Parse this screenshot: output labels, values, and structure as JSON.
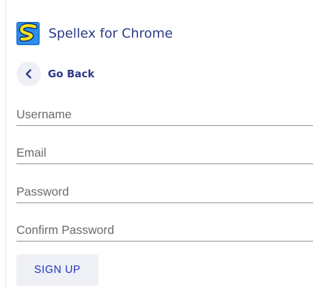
{
  "header": {
    "app_name": "Spellex for Chrome",
    "logo_icon": "spellex-logo-icon"
  },
  "nav": {
    "back_label": "Go Back",
    "back_icon": "chevron-left-icon"
  },
  "form": {
    "username_placeholder": "Username",
    "username_value": "",
    "email_placeholder": "Email",
    "email_value": "",
    "password_placeholder": "Password",
    "password_value": "",
    "confirm_password_placeholder": "Confirm Password",
    "confirm_password_value": "",
    "submit_label": "SIGN UP"
  },
  "colors": {
    "brand_text": "#2a3a86",
    "button_text": "#2233c0",
    "button_bg": "#eef0f5",
    "back_circle_bg": "#eef0f5",
    "field_underline": "#8a8a8a",
    "placeholder": "#6b6b6b"
  }
}
